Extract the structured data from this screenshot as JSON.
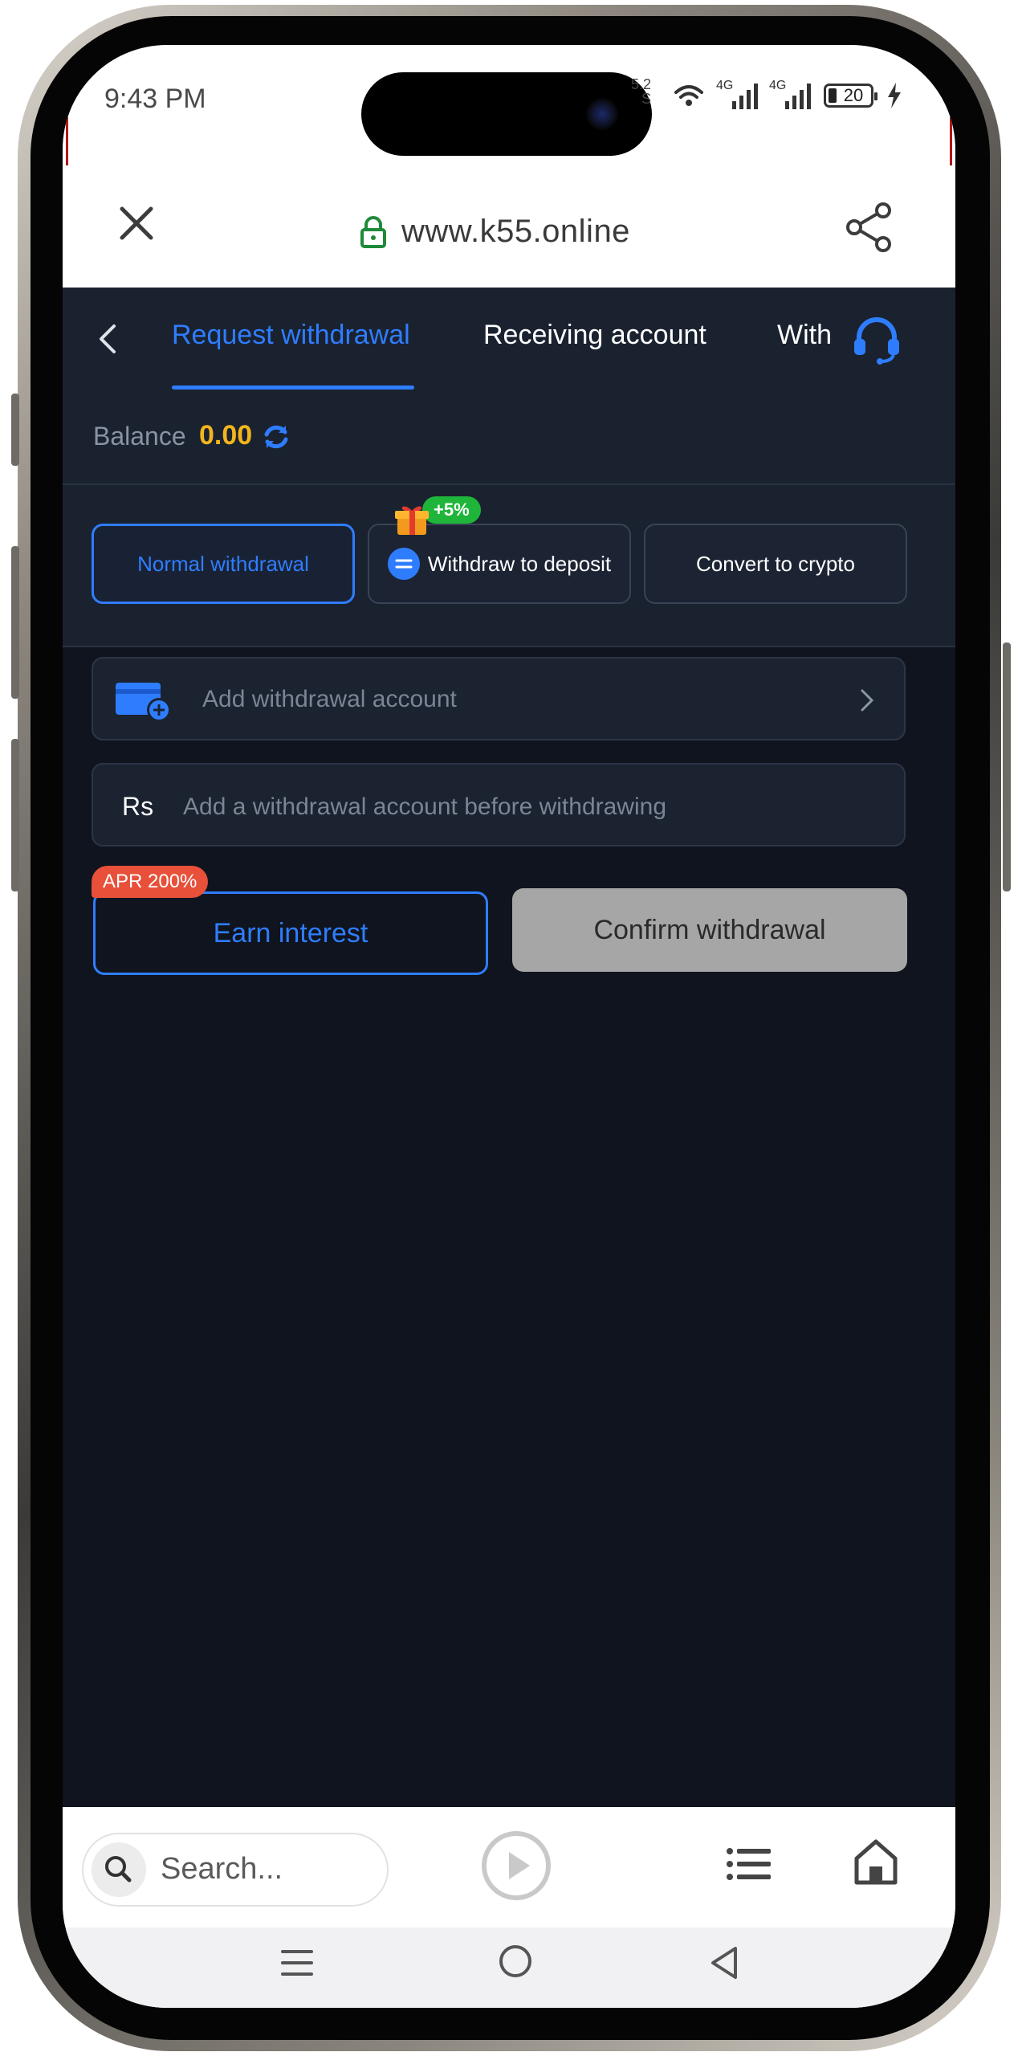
{
  "status_bar": {
    "time": "9:43 PM",
    "speed_value": "5.2",
    "speed_unit": "S",
    "network_1": "4G",
    "network_2": "4G",
    "battery": "20"
  },
  "browser": {
    "url": "www.k55.online",
    "icons": {
      "close": "close-icon",
      "lock": "lock-icon",
      "share": "share-icon"
    }
  },
  "app": {
    "tabs": [
      {
        "label": "Request withdrawal",
        "active": true
      },
      {
        "label": "Receiving account",
        "active": false
      },
      {
        "label": "With",
        "active": false
      }
    ],
    "balance": {
      "label": "Balance",
      "value": "0.00"
    },
    "withdraw_types": [
      {
        "label": "Normal withdrawal",
        "active": true
      },
      {
        "label": "Withdraw to deposit",
        "active": false,
        "badge": "+5%"
      },
      {
        "label": "Convert to crypto",
        "active": false
      }
    ],
    "account_field": {
      "placeholder": "Add withdrawal account"
    },
    "amount_field": {
      "currency": "Rs",
      "placeholder": "Add a withdrawal account before withdrawing"
    },
    "earn_button": {
      "label": "Earn interest",
      "badge": "APR 200%"
    },
    "confirm_button": {
      "label": "Confirm withdrawal",
      "disabled": true
    },
    "colors": {
      "accent": "#2f7dff",
      "balance": "#f3b51c",
      "background": "#0f141e",
      "panel": "#1a2230",
      "badge_green": "#1fb53a",
      "badge_red": "#e8503a"
    }
  },
  "bottom_bar": {
    "search_placeholder": "Search...",
    "icons": [
      "search-icon",
      "play-icon",
      "list-icon",
      "home-icon"
    ]
  },
  "system_nav": {
    "icons": [
      "menu-icon",
      "home-circle-icon",
      "back-triangle-icon"
    ]
  }
}
